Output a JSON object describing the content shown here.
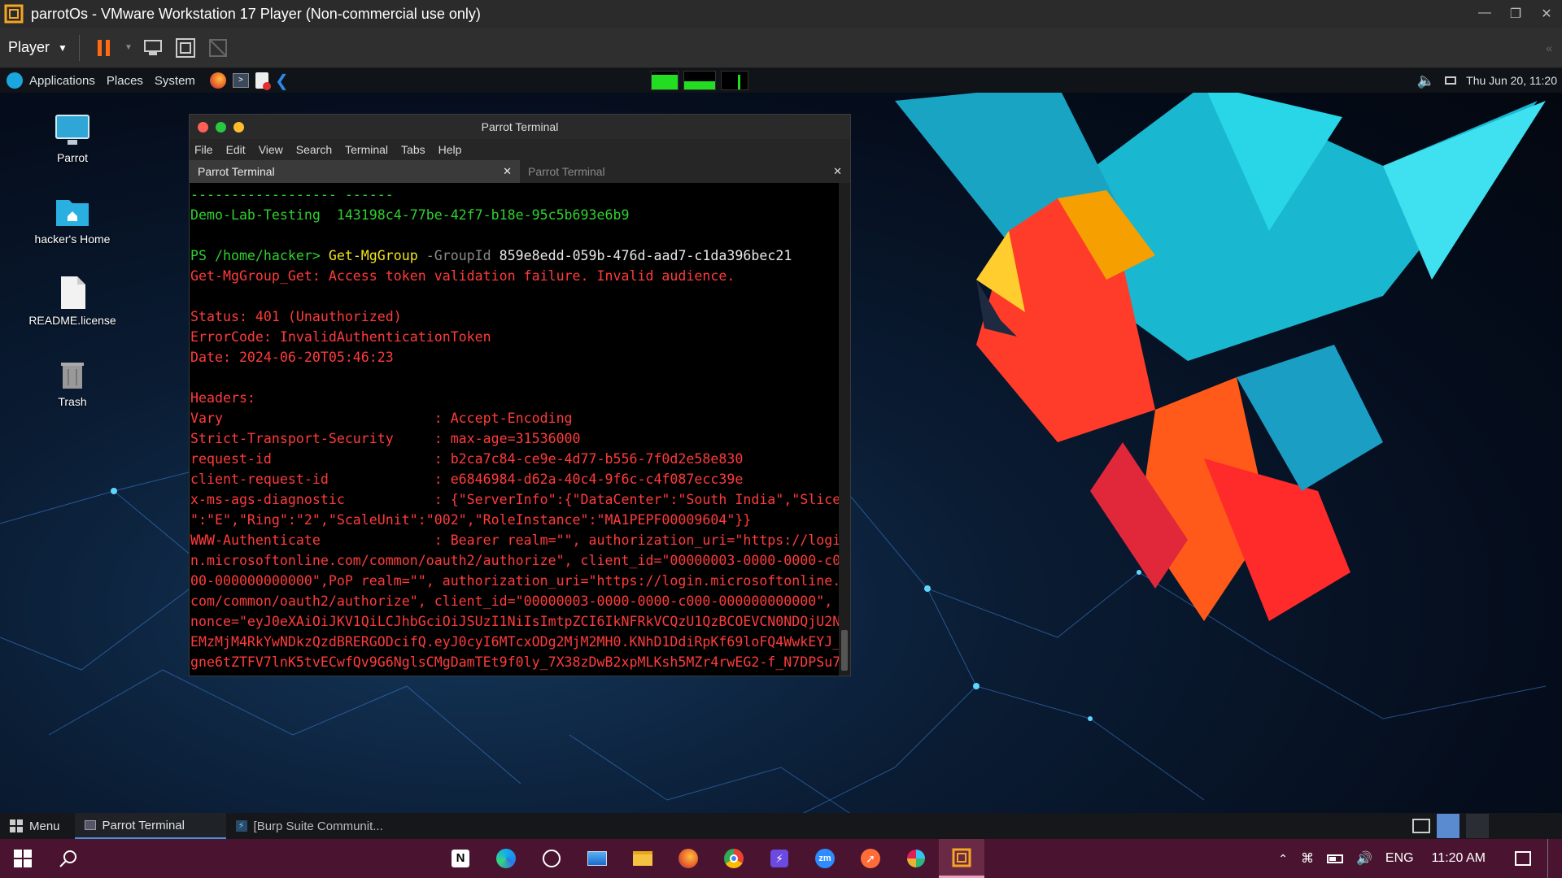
{
  "vm": {
    "title": "parrotOs - VMware Workstation 17 Player (Non-commercial use only)",
    "player_label": "Player"
  },
  "top_panel": {
    "menu": [
      "Applications",
      "Places",
      "System"
    ],
    "datetime": "Thu Jun 20, 11:20"
  },
  "desktop_icons": [
    {
      "label": "Parrot",
      "icon": "monitor-icon"
    },
    {
      "label": "hacker's Home",
      "icon": "home-folder-icon"
    },
    {
      "label": "README.license",
      "icon": "file-icon"
    },
    {
      "label": "Trash",
      "icon": "trash-icon"
    }
  ],
  "terminal": {
    "title": "Parrot Terminal",
    "menu": [
      "File",
      "Edit",
      "View",
      "Search",
      "Terminal",
      "Tabs",
      "Help"
    ],
    "tabs": [
      {
        "label": "Parrot Terminal",
        "active": true
      },
      {
        "label": "Parrot Terminal",
        "active": false
      }
    ],
    "lines": [
      {
        "segments": [
          {
            "text": "------------------ ------",
            "color": "green"
          }
        ]
      },
      {
        "segments": [
          {
            "text": "Demo-Lab-Testing  143198c4-77be-42f7-b18e-95c5b693e6b9",
            "color": "green"
          }
        ]
      },
      {
        "segments": [
          {
            "text": "",
            "color": "white"
          }
        ]
      },
      {
        "segments": [
          {
            "text": "PS /home/hacker> ",
            "color": "green"
          },
          {
            "text": "Get-MgGroup ",
            "color": "yellow"
          },
          {
            "text": "-GroupId ",
            "color": "grey"
          },
          {
            "text": "859e8edd-059b-476d-aad7-c1da396bec21",
            "color": "white"
          }
        ]
      },
      {
        "segments": [
          {
            "text": "Get-MgGroup_Get: Access token validation failure. Invalid audience.",
            "color": "red"
          }
        ]
      },
      {
        "segments": [
          {
            "text": "",
            "color": "red"
          }
        ]
      },
      {
        "segments": [
          {
            "text": "Status: 401 (Unauthorized)",
            "color": "red"
          }
        ]
      },
      {
        "segments": [
          {
            "text": "ErrorCode: InvalidAuthenticationToken",
            "color": "red"
          }
        ]
      },
      {
        "segments": [
          {
            "text": "Date: 2024-06-20T05:46:23",
            "color": "red"
          }
        ]
      },
      {
        "segments": [
          {
            "text": "",
            "color": "red"
          }
        ]
      },
      {
        "segments": [
          {
            "text": "Headers:",
            "color": "red"
          }
        ]
      },
      {
        "segments": [
          {
            "text": "Vary                          : Accept-Encoding",
            "color": "red"
          }
        ]
      },
      {
        "segments": [
          {
            "text": "Strict-Transport-Security     : max-age=31536000",
            "color": "red"
          }
        ]
      },
      {
        "segments": [
          {
            "text": "request-id                    : b2ca7c84-ce9e-4d77-b556-7f0d2e58e830",
            "color": "red"
          }
        ]
      },
      {
        "segments": [
          {
            "text": "client-request-id             : e6846984-d62a-40c4-9f6c-c4f087ecc39e",
            "color": "red"
          }
        ]
      },
      {
        "segments": [
          {
            "text": "x-ms-ags-diagnostic           : {\"ServerInfo\":{\"DataCenter\":\"South India\",\"Slice",
            "color": "red"
          }
        ]
      },
      {
        "segments": [
          {
            "text": "\":\"E\",\"Ring\":\"2\",\"ScaleUnit\":\"002\",\"RoleInstance\":\"MA1PEPF00009604\"}}",
            "color": "red"
          }
        ]
      },
      {
        "segments": [
          {
            "text": "WWW-Authenticate              : Bearer realm=\"\", authorization_uri=\"https://logi",
            "color": "red"
          }
        ]
      },
      {
        "segments": [
          {
            "text": "n.microsoftonline.com/common/oauth2/authorize\", client_id=\"00000003-0000-0000-c0",
            "color": "red"
          }
        ]
      },
      {
        "segments": [
          {
            "text": "00-000000000000\",PoP realm=\"\", authorization_uri=\"https://login.microsoftonline.",
            "color": "red"
          }
        ]
      },
      {
        "segments": [
          {
            "text": "com/common/oauth2/authorize\", client_id=\"00000003-0000-0000-c000-000000000000\",",
            "color": "red"
          }
        ]
      },
      {
        "segments": [
          {
            "text": "nonce=\"eyJ0eXAiOiJKV1QiLCJhbGciOiJSUzI1NiIsImtpZCI6IkNFRkVCQzU1QzBCOEVCN0NDQjU2N",
            "color": "red"
          }
        ]
      },
      {
        "segments": [
          {
            "text": "EMzMjM4RkYwNDkzQzdBRERGODcifQ.eyJ0cyI6MTcxODg2MjM2MH0.KNhD1DdiRpKf69loFQ4WwkEYJ_",
            "color": "red"
          }
        ]
      },
      {
        "segments": [
          {
            "text": "gne6tZTFV7lnK5tvECwfQv9G6NglsCMgDamTEt9f0ly_7X38zDwB2xpMLKsh5MZr4rwEG2-f_N7DPSu7",
            "color": "red"
          }
        ]
      }
    ]
  },
  "bottom_panel": {
    "menu_label": "Menu",
    "tasks": [
      {
        "label": "Parrot Terminal",
        "active": true
      },
      {
        "label": "[Burp Suite Communit...",
        "active": false
      }
    ]
  },
  "taskbar": {
    "apps": [
      "notion-icon",
      "edge-icon",
      "chatgpt-icon",
      "pc-icon",
      "file-explorer-icon",
      "firefox-icon",
      "chrome-icon",
      "power-automate-icon",
      "zoom-icon",
      "postman-icon",
      "slack-icon",
      "vmware-icon"
    ],
    "zoom_label": "zm",
    "notion_label": "N",
    "lang": "ENG",
    "time": "11:20 AM"
  },
  "colors": {
    "taskbar_bg": "#4a1430",
    "terminal_red": "#ff3b3b",
    "terminal_green": "#2ed12e",
    "terminal_yellow": "#f0e31a"
  }
}
